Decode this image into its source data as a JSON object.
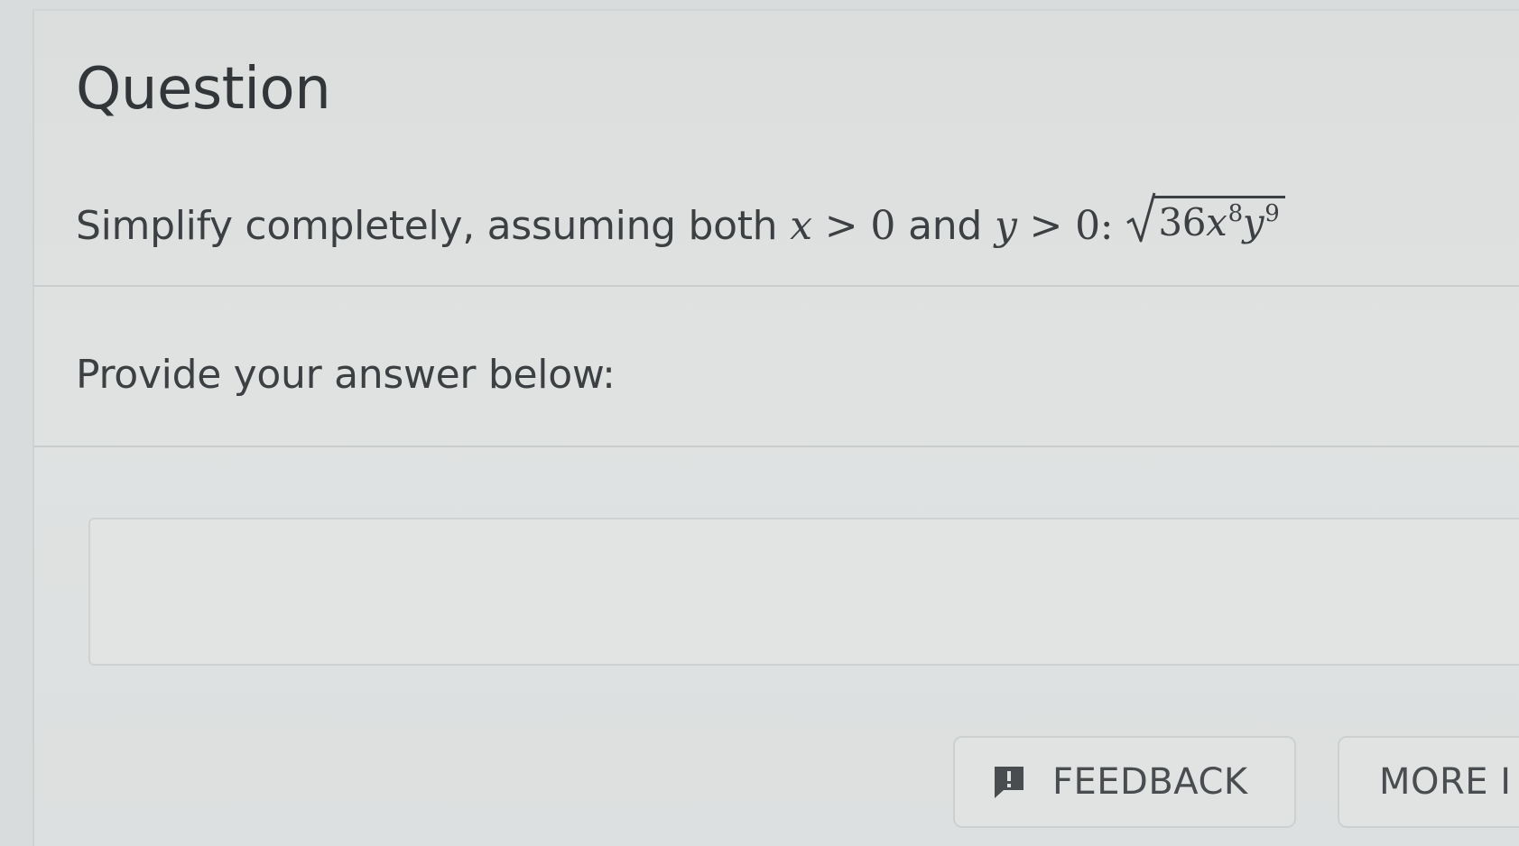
{
  "question": {
    "heading": "Question",
    "text": "Simplify completely, assuming both",
    "var_x": "x",
    "gt1": ">",
    "zero1": "0",
    "and": "and",
    "var_y": "y",
    "gt2": ">",
    "zero2": "0:",
    "radicand": {
      "coef": "36",
      "x": "x",
      "x_exp": "8",
      "y": "y",
      "y_exp": "9"
    }
  },
  "answer": {
    "prompt": "Provide your answer below:",
    "value": ""
  },
  "buttons": {
    "feedback": "FEEDBACK",
    "more": "MORE I"
  },
  "icons": {
    "feedback": "feedback-speech-icon",
    "radical": "square-root-icon"
  }
}
